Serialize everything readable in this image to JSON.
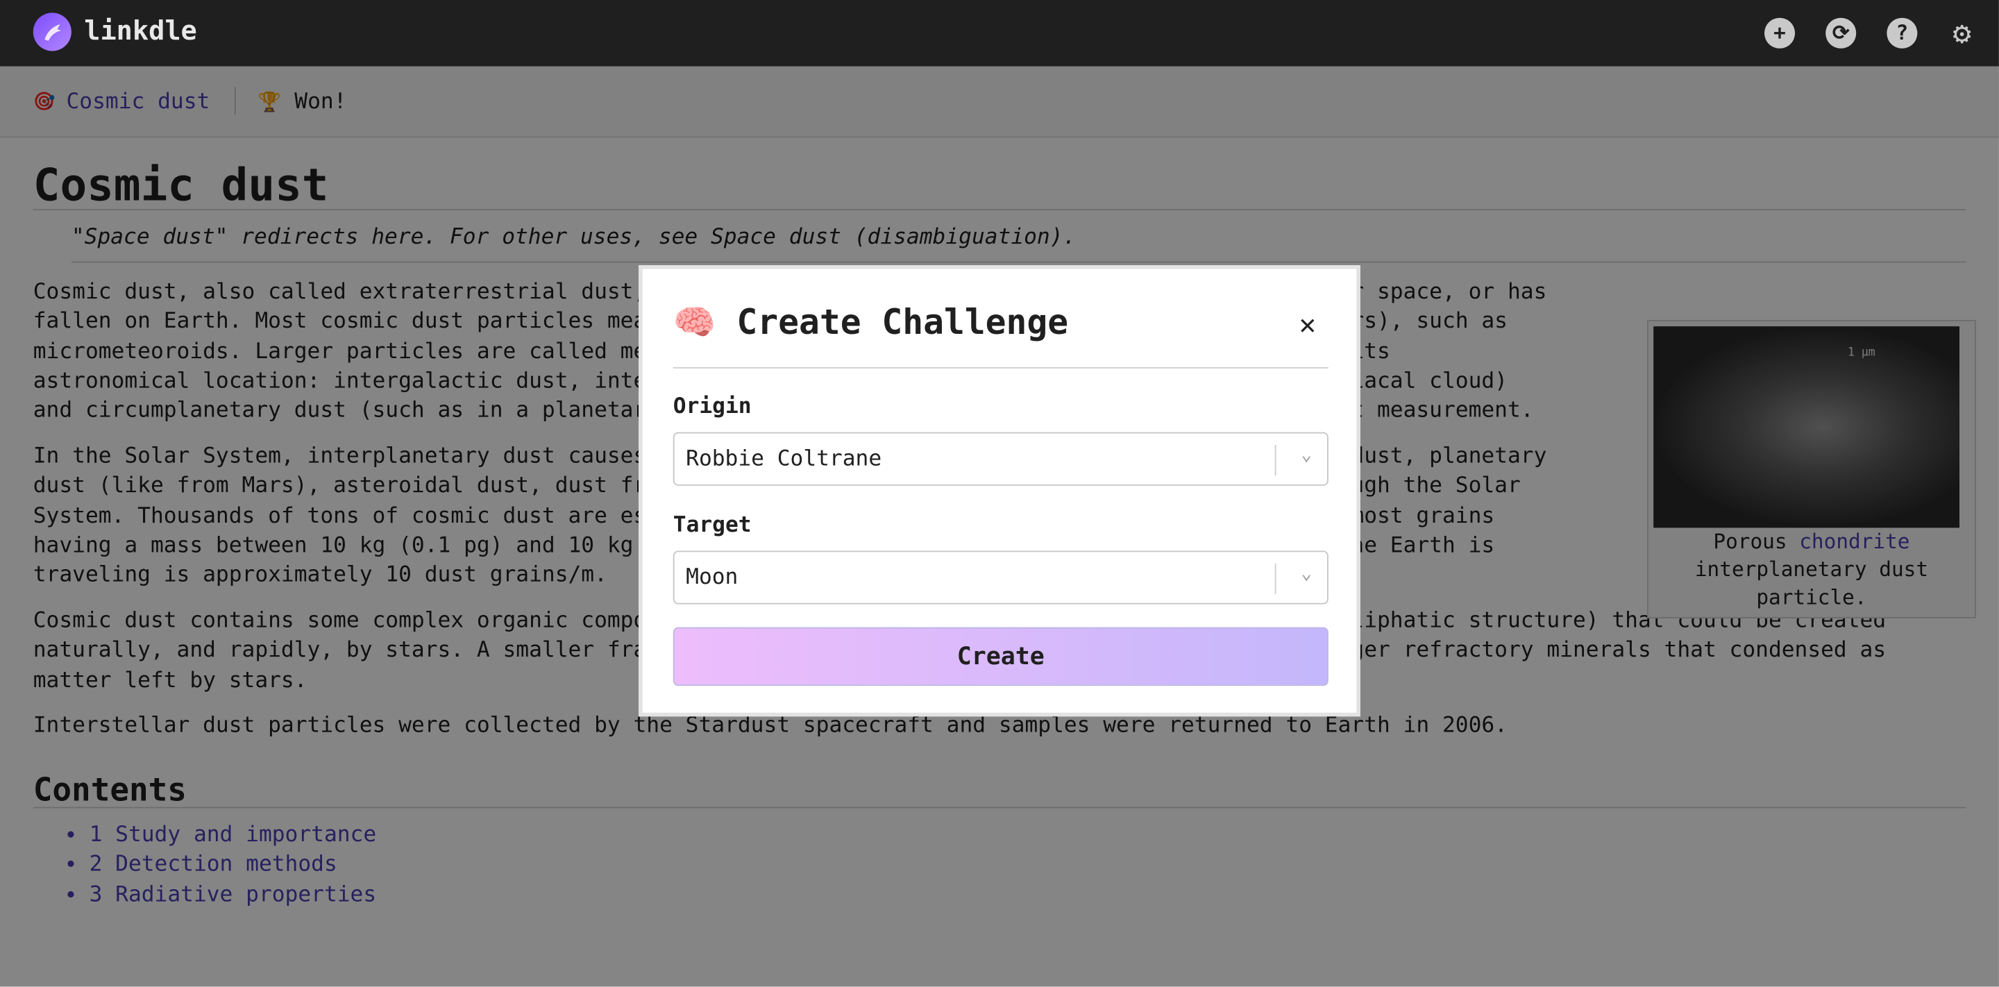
{
  "brand": {
    "name": "linkdle"
  },
  "toolbar": {
    "icons": [
      "plus-icon",
      "refresh-icon",
      "help-icon",
      "settings-icon"
    ],
    "plus": "+",
    "refresh": "⟳",
    "help": "?",
    "settings": "⚙"
  },
  "status": {
    "target_icon": "🎯",
    "target_label": "Cosmic dust",
    "trophy_icon": "🏆",
    "result": "Won!"
  },
  "article": {
    "title": "Cosmic dust",
    "hatnote": "\"Space dust\" redirects here. For other uses, see Space dust (disambiguation).",
    "p1_lines": [
      "Cosmic dust, also called extraterrestrial dust, star dust or space dust, is dust which exists in outer space, or has",
      "fallen on Earth. Most cosmic dust particles measure between a few molecules and 0.1 mm (100 micrometers), such as",
      "micrometeoroids. Larger particles are called meteoroids. Cosmic dust can be further distinguished by its",
      "astronomical location: intergalactic dust, interstellar dust, interplanetary dust (such as in the zodiacal cloud)",
      "and circumplanetary dust (such as in a planetary ring). There are several methods to obtain space dust measurement."
    ],
    "p2_lines": [
      "In the Solar System, interplanetary dust causes the zodiacal light. Solar System dust includes comet dust, planetary",
      "dust (like from Mars), asteroidal dust, dust from the Kuiper belt, and interstellar dust passing through the Solar",
      "System. Thousands of tons of cosmic dust are estimated to reach the Earth's surface every year, with most grains",
      "having a mass between 10 kg (0.1 pg) and 10 kg (0.1 g). The density of the dust cloud through which the Earth is",
      "traveling is approximately 10 dust grains/m."
    ],
    "p3_lines": [
      "Cosmic dust contains some complex organic compounds (amorphous organic solids with a mixed aromatic-aliphatic structure) that could be created",
      "naturally, and rapidly, by stars. A smaller fraction of dust in space is \"stardust\" consisting of larger refractory minerals that condensed as",
      "matter left by stars."
    ],
    "p4": "Interstellar dust particles were collected by the Stardust spacecraft and samples were returned to Earth in 2006.",
    "caption_pre": "Porous ",
    "caption_link": "chondrite",
    "caption_post": "interplanetary dust particle.",
    "image_scale": "1 μm",
    "contents_title": "Contents",
    "contents": [
      "1 Study and importance",
      "2 Detection methods",
      "3 Radiative properties"
    ]
  },
  "modal": {
    "icon": "🧠",
    "title": "Create Challenge",
    "close": "✕",
    "origin_label": "Origin",
    "origin_value": "Robbie Coltrane",
    "target_label": "Target",
    "target_value": "Moon",
    "chevron": "⌄",
    "create_label": "Create"
  }
}
